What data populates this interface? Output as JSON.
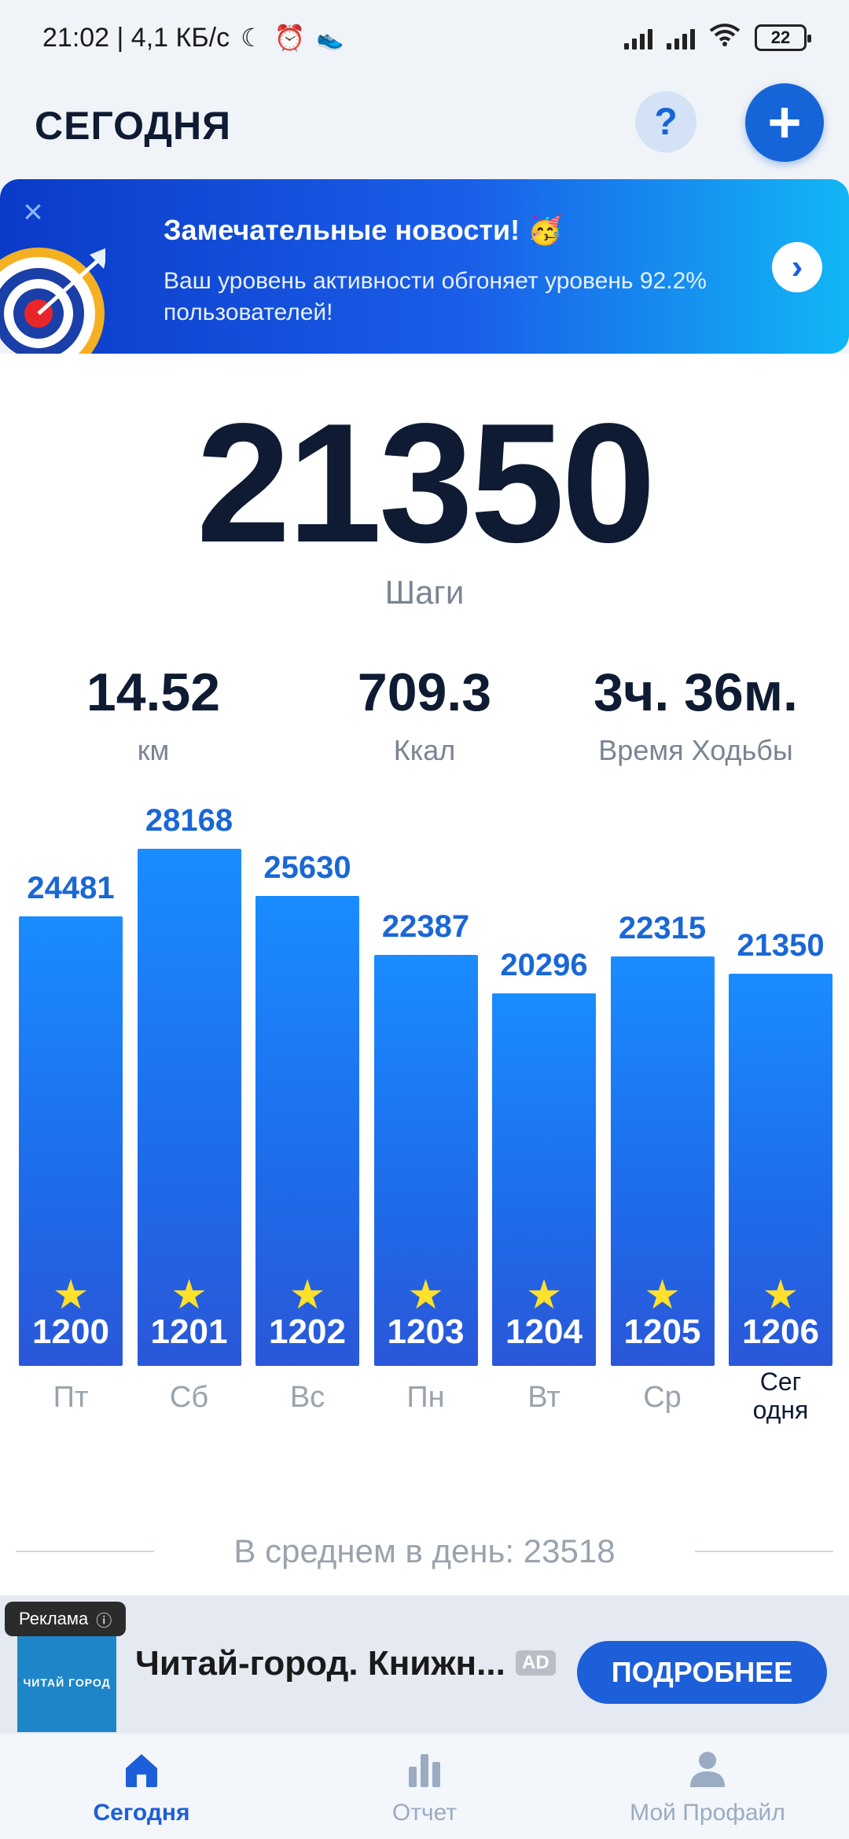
{
  "status_bar": {
    "time_speed": "21:02 | 4,1 КБ/с",
    "battery": "22"
  },
  "header": {
    "title": "СЕГОДНЯ",
    "help_label": "?",
    "add_label": "+"
  },
  "banner": {
    "title": "Замечательные новости! 🥳",
    "text": "Ваш уровень активности обгоняет уровень 92.2% пользователей!",
    "close_label": "×",
    "arrow_label": "›"
  },
  "today": {
    "steps": "21350",
    "steps_label": "Шаги",
    "distance": "14.52",
    "distance_unit": "км",
    "calories": "709.3",
    "calories_unit": "Ккал",
    "time": "3ч. 36м.",
    "time_label": "Время Ходьбы"
  },
  "chart_data": {
    "type": "bar",
    "categories": [
      "Пт",
      "Сб",
      "Вс",
      "Пн",
      "Вт",
      "Ср",
      "Сег одня"
    ],
    "values": [
      24481,
      28168,
      25630,
      22387,
      20296,
      22315,
      21350
    ],
    "badges": [
      "1200",
      "1201",
      "1202",
      "1203",
      "1204",
      "1205",
      "1206"
    ],
    "badge_icon": "star-icon",
    "bar_color": "#1e6bea",
    "value_color": "#1a67d6",
    "average_label": "В среднем в день: 23518"
  },
  "ad": {
    "badge": "Реклама",
    "title": "Читай-город. Книжн...",
    "tag": "AD",
    "cta": "ПОДРОБНЕЕ",
    "logo_text": "ЧИТАЙ ГОРОД"
  },
  "nav": {
    "items": [
      {
        "label": "Сегодня",
        "icon": "home-icon",
        "active": true
      },
      {
        "label": "Отчет",
        "icon": "bar-chart-icon",
        "active": false
      },
      {
        "label": "Мой Профайл",
        "icon": "profile-icon",
        "active": false
      }
    ]
  },
  "colors": {
    "accent": "#1d5fd8",
    "text": "#0e1b33",
    "muted": "#9aa3ad",
    "star": "#ffe02a"
  }
}
